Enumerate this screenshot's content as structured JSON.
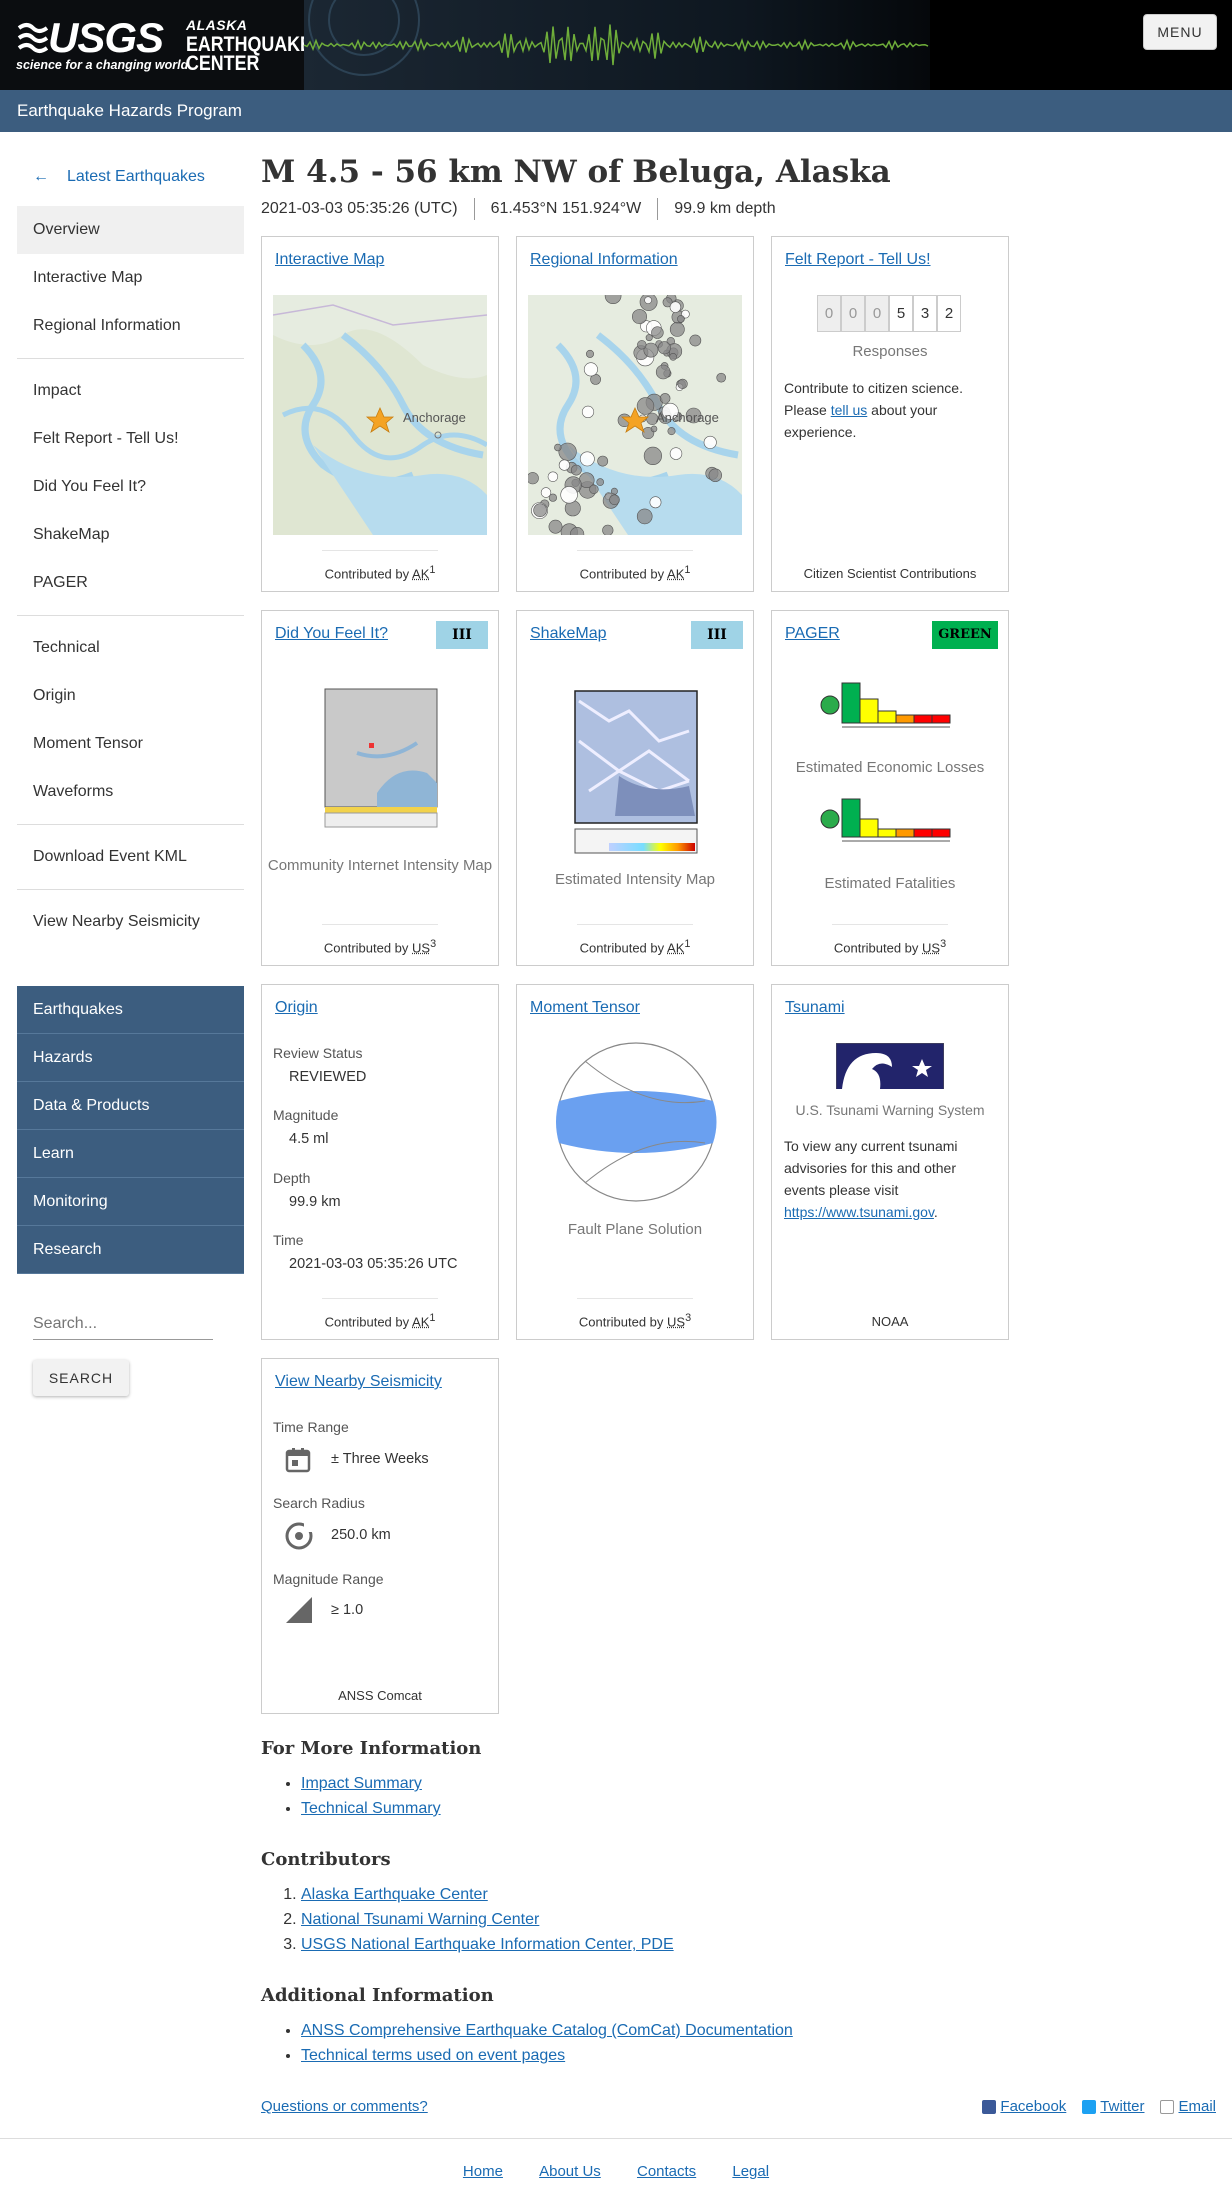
{
  "header": {
    "usgs": "USGS",
    "tagline": "science for a changing world",
    "center_line1": "ALASKA",
    "center_line2": "EARTHQUAKE",
    "center_line3": "CENTER",
    "menu_label": "MENU",
    "program": "Earthquake Hazards Program"
  },
  "sidebar": {
    "back_arrow": "←",
    "back_label": "Latest Earthquakes",
    "group1": [
      "Overview",
      "Interactive Map",
      "Regional Information"
    ],
    "group2": [
      "Impact",
      "Felt Report - Tell Us!",
      "Did You Feel It?",
      "ShakeMap",
      "PAGER"
    ],
    "group3": [
      "Technical",
      "Origin",
      "Moment Tensor",
      "Waveforms"
    ],
    "group4": [
      "Download Event KML"
    ],
    "group5": [
      "View Nearby Seismicity"
    ],
    "site_nav": [
      "Earthquakes",
      "Hazards",
      "Data & Products",
      "Learn",
      "Monitoring",
      "Research"
    ],
    "search_placeholder": "Search...",
    "search_button": "SEARCH"
  },
  "event": {
    "title": "M 4.5 - 56 km NW of Beluga, Alaska",
    "time": "2021-03-03 05:35:26 (UTC)",
    "location": "61.453°N 151.924°W",
    "depth": "99.9 km depth"
  },
  "cards": {
    "interactive_map": {
      "title": "Interactive Map",
      "map_label": "Anchorage",
      "contrib_prefix": "Contributed by",
      "contrib": "AK",
      "sup": "1"
    },
    "regional": {
      "title": "Regional Information",
      "map_label": "Anchorage",
      "contrib_prefix": "Contributed by",
      "contrib": "AK",
      "sup": "1"
    },
    "felt": {
      "title": "Felt Report - Tell Us!",
      "digits": [
        "0",
        "0",
        "0",
        "5",
        "3",
        "2"
      ],
      "responses": "Responses",
      "text_before": "Contribute to citizen science. Please",
      "link": "tell us",
      "text_after": "about your experience.",
      "footer": "Citizen Scientist Contributions"
    },
    "dyfi": {
      "title": "Did You Feel It?",
      "badge": "III",
      "caption": "Community Internet Intensity Map",
      "contrib_prefix": "Contributed by",
      "contrib": "US",
      "sup": "3"
    },
    "shakemap": {
      "title": "ShakeMap",
      "badge": "III",
      "caption": "Estimated Intensity Map",
      "contrib_prefix": "Contributed by",
      "contrib": "AK",
      "sup": "1"
    },
    "pager": {
      "title": "PAGER",
      "badge": "GREEN",
      "caption1": "Estimated Economic Losses",
      "caption2": "Estimated Fatalities",
      "contrib_prefix": "Contributed by",
      "contrib": "US",
      "sup": "3"
    },
    "origin": {
      "title": "Origin",
      "review_label": "Review Status",
      "review_value": "REVIEWED",
      "mag_label": "Magnitude",
      "mag_value": "4.5 ml",
      "depth_label": "Depth",
      "depth_value": "99.9 km",
      "time_label": "Time",
      "time_value": "2021-03-03 05:35:26 UTC",
      "contrib_prefix": "Contributed by",
      "contrib": "AK",
      "sup": "1"
    },
    "moment": {
      "title": "Moment Tensor",
      "caption": "Fault Plane Solution",
      "contrib_prefix": "Contributed by",
      "contrib": "US",
      "sup": "3"
    },
    "tsunami": {
      "title": "Tsunami",
      "caption": "U.S. Tsunami Warning System",
      "text": "To view any current tsunami advisories for this and other events please visit",
      "link": "https://www.tsunami.gov",
      "period": ".",
      "footer": "NOAA"
    },
    "nearby": {
      "title": "View Nearby Seismicity",
      "time_label": "Time Range",
      "time_value": "± Three Weeks",
      "radius_label": "Search Radius",
      "radius_value": "250.0 km",
      "mag_label": "Magnitude Range",
      "mag_value": "≥ 1.0",
      "footer": "ANSS Comcat"
    }
  },
  "more_info": {
    "heading": "For More Information",
    "links": [
      "Impact Summary",
      "Technical Summary"
    ]
  },
  "contributors": {
    "heading": "Contributors",
    "links": [
      "Alaska Earthquake Center",
      "National Tsunami Warning Center",
      "USGS National Earthquake Information Center, PDE"
    ]
  },
  "additional": {
    "heading": "Additional Information",
    "links": [
      "ANSS Comprehensive Earthquake Catalog (ComCat) Documentation",
      "Technical terms used on event pages"
    ]
  },
  "comments": "Questions or comments?",
  "social": [
    "Facebook",
    "Twitter",
    "Email"
  ],
  "footer_links": [
    "Home",
    "About Us",
    "Contacts",
    "Legal"
  ],
  "colors": {
    "accent": "#1a6bb3",
    "nav_bg": "#3c5d7f",
    "pager_green": "#00b050",
    "mmi_iii": "#9fd3e6"
  }
}
